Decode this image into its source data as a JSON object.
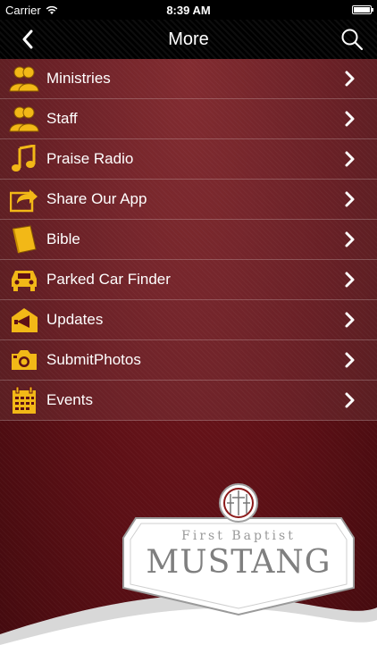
{
  "status_bar": {
    "carrier": "Carrier",
    "time": "8:39 AM"
  },
  "navbar": {
    "title": "More"
  },
  "menu": {
    "items": [
      {
        "label": "Ministries",
        "icon": "people-icon"
      },
      {
        "label": "Staff",
        "icon": "people-icon"
      },
      {
        "label": "Praise Radio",
        "icon": "music-note-icon"
      },
      {
        "label": "Share Our App",
        "icon": "share-icon"
      },
      {
        "label": "Bible",
        "icon": "book-icon"
      },
      {
        "label": "Parked Car Finder",
        "icon": "car-icon"
      },
      {
        "label": "Updates",
        "icon": "megaphone-icon"
      },
      {
        "label": "SubmitPhotos",
        "icon": "camera-icon"
      },
      {
        "label": "Events",
        "icon": "calendar-icon"
      }
    ]
  },
  "logo": {
    "line1": "First Baptist",
    "line2": "MUSTANG"
  },
  "colors": {
    "accent": "#f2b817",
    "background": "#5e1016",
    "navbar": "#000000"
  }
}
